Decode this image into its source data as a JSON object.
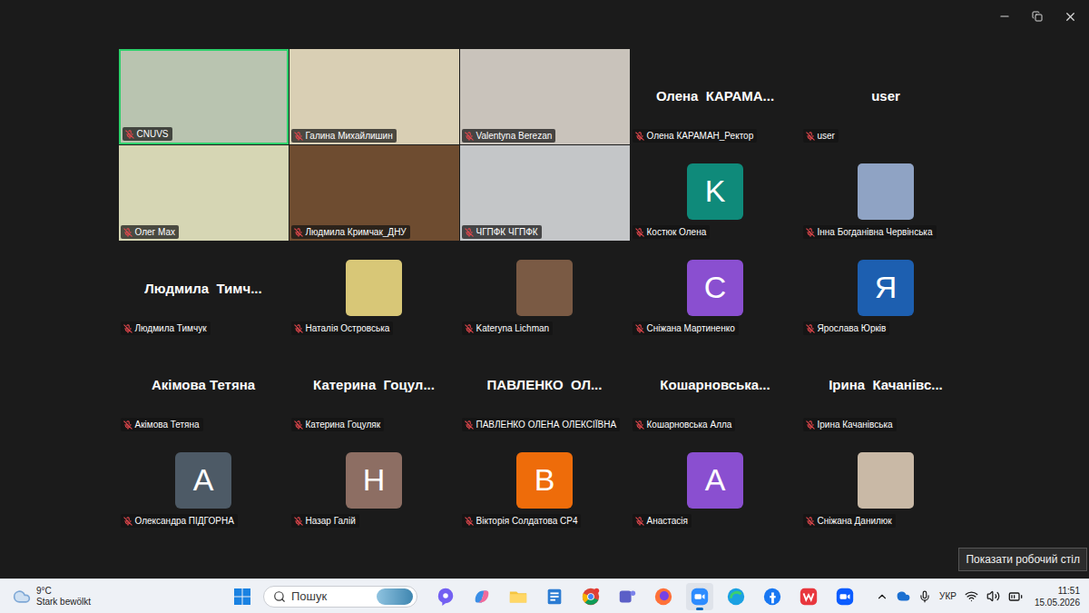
{
  "participants": [
    {
      "name": "CNUVS",
      "kind": "video",
      "color": "#b9c4b0",
      "muted": true,
      "highlighted": true
    },
    {
      "name": "Галина Михайлишин",
      "kind": "video",
      "color": "#d9cfb4",
      "muted": true,
      "highlighted": false
    },
    {
      "name": "Valentyna Berezan",
      "kind": "video",
      "color": "#c9c3bb",
      "muted": true,
      "highlighted": false
    },
    {
      "name": "Олена КАРАМАН_Ректор",
      "kind": "name",
      "display": "Олена  КАРАМА...",
      "muted": true,
      "highlighted": false
    },
    {
      "name": "user",
      "kind": "name",
      "display": "user",
      "muted": true,
      "highlighted": false
    },
    {
      "name": "Олег Мах",
      "kind": "video",
      "color": "#d6d6b4",
      "muted": true,
      "highlighted": false
    },
    {
      "name": "Людмила Кримчак_ДНУ",
      "kind": "video",
      "color": "#6e4c30",
      "muted": true,
      "highlighted": false
    },
    {
      "name": "ЧГПФК ЧГПФК",
      "kind": "video",
      "color": "#c4c6c8",
      "muted": true,
      "highlighted": false
    },
    {
      "name": "Костюк Олена",
      "kind": "letter",
      "letter": "K",
      "color": "#0f8a7a",
      "muted": true,
      "highlighted": false
    },
    {
      "name": "Інна Богданівна Червінська",
      "kind": "photo",
      "color": "#8fa3c4",
      "muted": true,
      "highlighted": false
    },
    {
      "name": "Людмила Тимчук",
      "kind": "name",
      "display": "Людмила  Тимч...",
      "muted": true,
      "highlighted": false
    },
    {
      "name": "Наталія Островська",
      "kind": "photo",
      "color": "#d8c777",
      "muted": true,
      "highlighted": false
    },
    {
      "name": "Kateryna Lichman",
      "kind": "photo",
      "color": "#7a5a44",
      "muted": true,
      "highlighted": false
    },
    {
      "name": "Сніжана Мартиненко",
      "kind": "letter",
      "letter": "С",
      "color": "#8a4fd0",
      "muted": true,
      "highlighted": false
    },
    {
      "name": "Ярослава Юрків",
      "kind": "letter",
      "letter": "Я",
      "color": "#1d5fb0",
      "muted": true,
      "highlighted": false
    },
    {
      "name": "Акімова Тетяна",
      "kind": "name",
      "display": "Акімова Тетяна",
      "muted": true,
      "highlighted": false
    },
    {
      "name": "Катерина Гоцуляк",
      "kind": "name",
      "display": "Катерина  Гоцул...",
      "muted": true,
      "highlighted": false
    },
    {
      "name": "ПАВЛЕНКО ОЛЕНА ОЛЕКСІЇВНА",
      "kind": "name",
      "display": "ПАВЛЕНКО  ОЛ...",
      "muted": true,
      "highlighted": false
    },
    {
      "name": "Кошарновська Алла",
      "kind": "name",
      "display": "Кошарновська...",
      "muted": true,
      "highlighted": false
    },
    {
      "name": "Ірина Качанівська",
      "kind": "name",
      "display": "Ірина  Качанівс...",
      "muted": true,
      "highlighted": false
    },
    {
      "name": "Олександра ПІДГОРНА",
      "kind": "letter",
      "letter": "A",
      "color": "#4d5a66",
      "muted": true,
      "highlighted": false
    },
    {
      "name": "Назар Галій",
      "kind": "letter",
      "letter": "Н",
      "color": "#8d6e63",
      "muted": true,
      "highlighted": false
    },
    {
      "name": "Вікторія Солдатова СР4",
      "kind": "letter",
      "letter": "В",
      "color": "#ee6c0a",
      "muted": true,
      "highlighted": false
    },
    {
      "name": "Анастасія",
      "kind": "letter",
      "letter": "А",
      "color": "#8a4fd0",
      "muted": true,
      "highlighted": false
    },
    {
      "name": "Сніжана Данилюк",
      "kind": "photo",
      "color": "#c9b9a6",
      "muted": true,
      "highlighted": false
    }
  ],
  "tooltip": {
    "text": "Показати робочий стіл"
  },
  "taskbar": {
    "weather": {
      "temperature": "9°C",
      "condition": "Stark bewölkt"
    },
    "search": {
      "placeholder": "Пошук"
    },
    "apps": [
      {
        "kind": "viber",
        "color": "#7360f2",
        "active": false
      },
      {
        "kind": "copilot",
        "color": "#3a8ee6",
        "active": false
      },
      {
        "kind": "folder",
        "color": "#f4c542",
        "active": false
      },
      {
        "kind": "notes",
        "color": "#2b7cd3",
        "active": false
      },
      {
        "kind": "chrome",
        "color": "#4285f4",
        "active": false
      },
      {
        "kind": "teams",
        "color": "#5b5fc7",
        "active": false
      },
      {
        "kind": "firefox",
        "color": "#ff7139",
        "active": false
      },
      {
        "kind": "zoom",
        "color": "#2d8cff",
        "active": true
      },
      {
        "kind": "edge",
        "color": "#1ba1e2",
        "active": false
      },
      {
        "kind": "facebook",
        "color": "#1877f2",
        "active": false
      },
      {
        "kind": "wps",
        "color": "#e8373e",
        "active": false
      },
      {
        "kind": "workplace",
        "color": "#0b5cff",
        "active": false
      }
    ],
    "tray": {
      "language": "УКР",
      "time": "11:51",
      "date": "15.05.2026"
    }
  }
}
